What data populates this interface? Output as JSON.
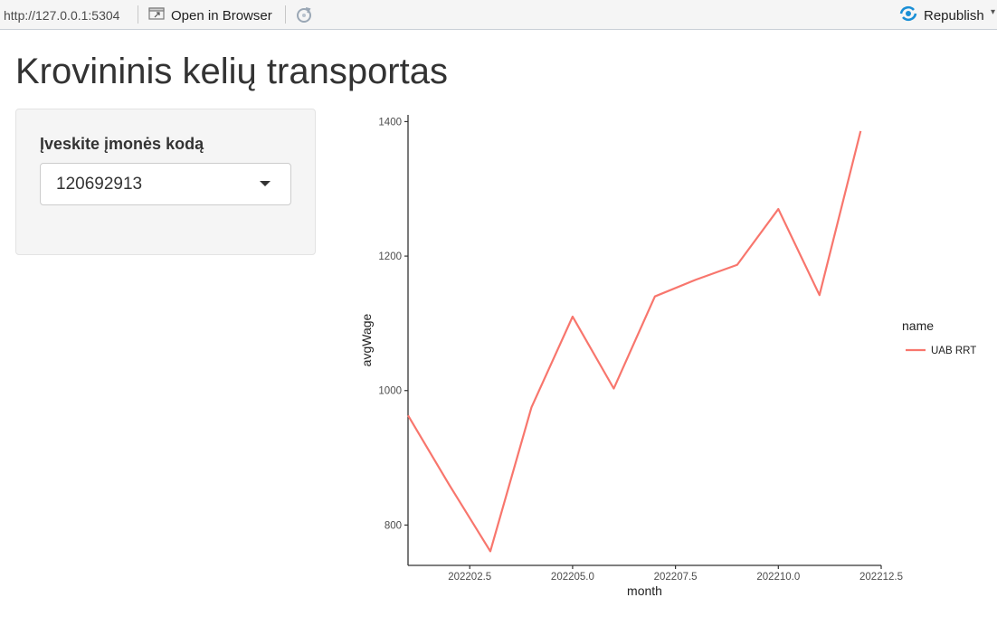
{
  "toolbar": {
    "url": "http://127.0.0.1:5304",
    "open_in_browser_label": "Open in Browser",
    "republish_label": "Republish",
    "icons": {
      "open_in_browser": "open-in-browser-icon",
      "refresh": "refresh-icon",
      "republish": "republish-icon"
    },
    "republish_icon_color": "#1a8fd6"
  },
  "page": {
    "title": "Krovininis kelių transportas"
  },
  "sidebar": {
    "company_code_label": "Įveskite įmonės kodą",
    "company_code_value": "120692913"
  },
  "chart_data": {
    "type": "line",
    "xlabel": "month",
    "ylabel": "avgWage",
    "xlim": [
      202201,
      202212.5
    ],
    "ylim": [
      740,
      1410
    ],
    "x_ticks": [
      202202.5,
      202205.0,
      202207.5,
      202210.0,
      202212.5
    ],
    "x_tick_labels": [
      "202202.5",
      "202205.0",
      "202207.5",
      "202210.0",
      "202212.5"
    ],
    "y_ticks": [
      800,
      1000,
      1200,
      1400
    ],
    "y_tick_labels": [
      "800",
      "1000",
      "1200",
      "1400"
    ],
    "grid": false,
    "legend_title": "name",
    "legend_position": "right",
    "series": [
      {
        "name": "UAB RRT",
        "color": "#f8766d",
        "x": [
          202201,
          202202,
          202203,
          202204,
          202205,
          202206,
          202207,
          202208,
          202209,
          202210,
          202211,
          202212
        ],
        "y": [
          963,
          860,
          761,
          975,
          1110,
          1003,
          1140,
          1165,
          1187,
          1270,
          1142,
          1386
        ]
      }
    ]
  }
}
